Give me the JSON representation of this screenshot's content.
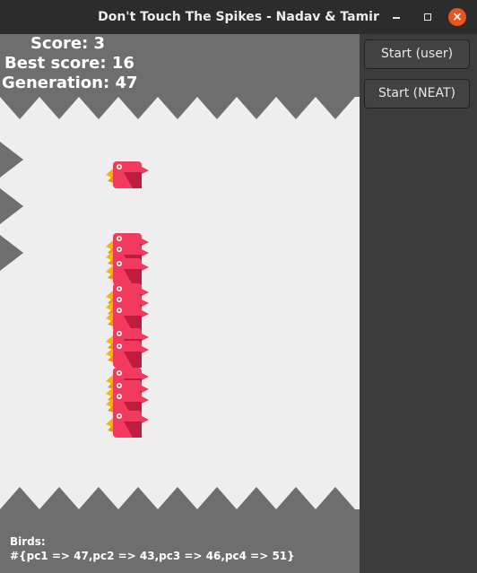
{
  "window": {
    "title": "Don't Touch The Spikes - Nadav & Tamir",
    "close_glyph": "×"
  },
  "hud": {
    "score": "Score: 3",
    "best": "Best score: 16",
    "generation": "Generation: 47"
  },
  "birds_panel": {
    "label": "Birds:",
    "value": "#{pc1 => 47,pc2 => 43,pc3 => 46,pc4 => 51}"
  },
  "controls": {
    "start_user": "Start (user)",
    "start_neat": "Start (NEAT)"
  },
  "colors": {
    "bird_body": "#f23a5f",
    "bird_shade": "#c01c3e",
    "beak": "#f5b800",
    "spike": "#6e6e6e",
    "background": "#eeeeee"
  }
}
